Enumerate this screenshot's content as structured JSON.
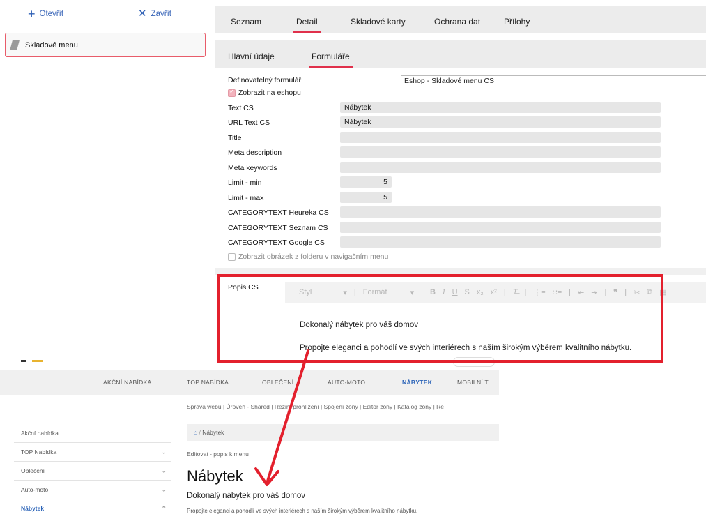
{
  "toolbar": {
    "open_label": "Otevřít",
    "close_label": "Zavřít"
  },
  "sidebar": {
    "item_label": "Skladové menu"
  },
  "tabs": [
    "Seznam",
    "Detail",
    "Skladové karty",
    "Ochrana dat",
    "Přílohy"
  ],
  "subtabs": [
    "Hlavní údaje",
    "Formuláře"
  ],
  "form": {
    "definable_label": "Definovatelný formulář:",
    "definable_value": "Eshop - Skladové menu CS",
    "show_eshop_label": "Zobrazit na eshopu",
    "fields": [
      {
        "label": "Text CS",
        "value": "Nábytek"
      },
      {
        "label": "URL Text CS",
        "value": "Nábytek"
      },
      {
        "label": "Title",
        "value": ""
      },
      {
        "label": "Meta description",
        "value": ""
      },
      {
        "label": "Meta keywords",
        "value": ""
      },
      {
        "label": "Limit - min",
        "value": "5"
      },
      {
        "label": "Limit - max",
        "value": "5"
      },
      {
        "label": "CATEGORYTEXT Heureka CS",
        "value": ""
      },
      {
        "label": "CATEGORYTEXT Seznam CS",
        "value": ""
      },
      {
        "label": "CATEGORYTEXT Google CS",
        "value": ""
      }
    ],
    "show_image_label": "Zobrazit obrázek z folderu v navigačním menu",
    "popis_label": "Popis CS"
  },
  "editor": {
    "styl": "Styl",
    "format": "Formát",
    "line1": "Dokonalý nábytek pro váš domov",
    "line2": "Propojte eleganci a pohodlí ve svých interiérech s naším širokým výběrem kvalitního nábytku."
  },
  "website": {
    "nav": [
      "AKČNÍ NABÍDKA",
      "TOP NABÍDKA",
      "OBLEČENÍ",
      "AUTO-MOTO",
      "NÁBYTEK",
      "MOBILNÍ T"
    ],
    "nav_active": "NÁBYTEK",
    "admin_links": "Správa webu | Úroveň - Shared | Režim prohlížení | Spojení zóny | Editor zóny | Katalog zóny | Re",
    "side_items": [
      "Akční nabídka",
      "TOP Nabídka",
      "Oblečení",
      "Auto-moto",
      "Nábytek"
    ],
    "breadcrumb": "Nábytek",
    "edit_link": "Editovat - popis k menu",
    "heading": "Nábytek",
    "subheading": "Dokonalý nábytek pro váš domov",
    "paragraph": "Propojte eleganci a pohodlí ve svých interiérech s naším širokým výběrem kvalitního nábytku."
  },
  "colors": {
    "accent": "#e0304b",
    "link_blue": "#2c64b8",
    "annotation_red": "#e3202d"
  }
}
